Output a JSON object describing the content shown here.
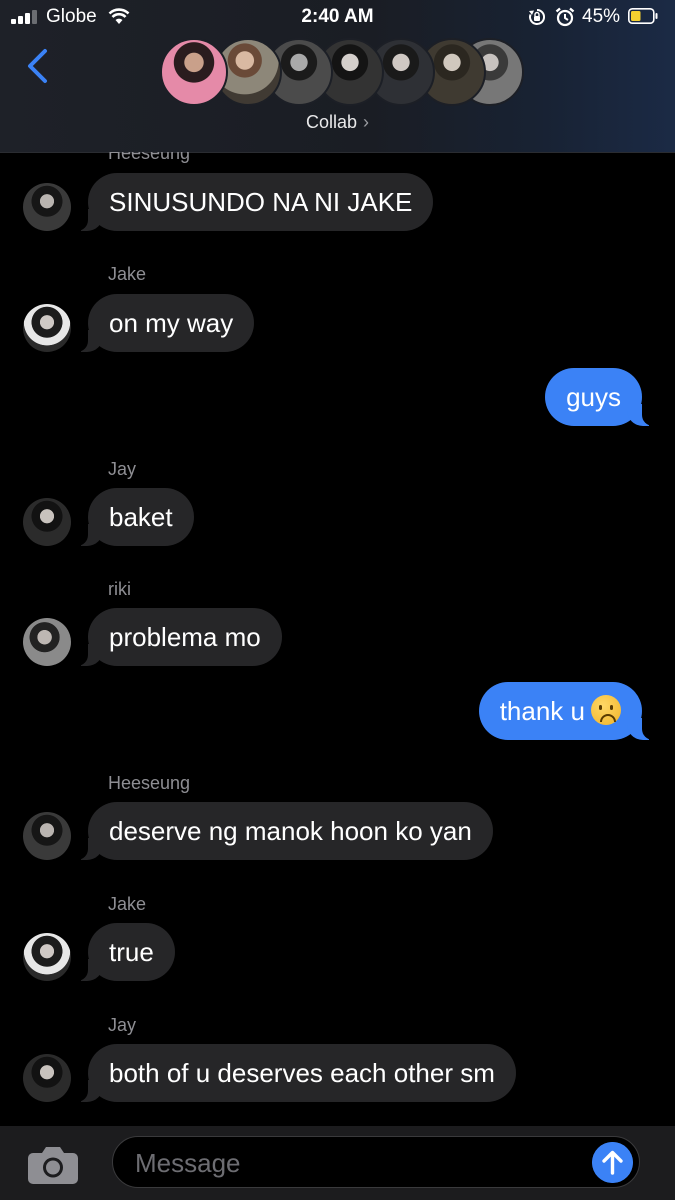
{
  "status_bar": {
    "carrier": "Globe",
    "time": "2:40 AM",
    "battery_percent": "45%",
    "battery_level": 0.45,
    "battery_color": "#f5d130",
    "icons": [
      "signal-icon",
      "wifi-icon",
      "rotation-lock-icon",
      "alarm-icon",
      "battery-icon"
    ]
  },
  "header": {
    "back_icon": "chevron-left-icon",
    "group_name": "Collab",
    "group_chevron": "›",
    "member_count": 7
  },
  "messages": [
    {
      "sender": "Heeseung",
      "text": "SINUSUNDO NA NI JAKE",
      "direction": "incoming"
    },
    {
      "sender": "Jake",
      "text": "on my way",
      "direction": "incoming"
    },
    {
      "sender": "",
      "text": "guys",
      "direction": "outgoing"
    },
    {
      "sender": "Jay",
      "text": "baket",
      "direction": "incoming"
    },
    {
      "sender": "riki",
      "text": "problema mo",
      "direction": "incoming"
    },
    {
      "sender": "",
      "text": "thank u",
      "emoji": "frowning-face",
      "direction": "outgoing"
    },
    {
      "sender": "Heeseung",
      "text": "deserve ng manok hoon ko yan",
      "direction": "incoming"
    },
    {
      "sender": "Jake",
      "text": "true",
      "direction": "incoming"
    },
    {
      "sender": "Jay",
      "text": "both of u deserves each other sm",
      "direction": "incoming"
    }
  ],
  "composer": {
    "camera_icon": "camera-icon",
    "placeholder": "Message",
    "send_icon": "arrow-up-icon"
  },
  "colors": {
    "outgoing_bubble": "#3b82f6",
    "incoming_bubble": "#262628",
    "accent": "#3b82f6"
  }
}
